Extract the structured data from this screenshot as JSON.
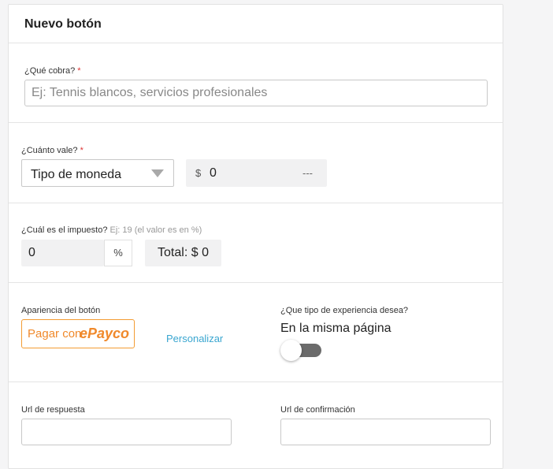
{
  "header": {
    "title": "Nuevo botón"
  },
  "charge": {
    "label": "¿Qué cobra?",
    "required_mark": "*",
    "placeholder": "Ej: Tennis blancos, servicios profesionales"
  },
  "price": {
    "label": "¿Cuánto vale?",
    "required_mark": "*",
    "currency_select": "Tipo de moneda",
    "currency_symbol": "$",
    "amount": "0",
    "amount_suffix": "---"
  },
  "tax": {
    "label": "¿Cuál es el impuesto?",
    "hint": "Ej: 19 (el valor es en %)",
    "value": "0",
    "unit": "%",
    "total": "Total: $ 0"
  },
  "appearance": {
    "label": "Apariencia del botón",
    "button_prefix": "Pagar con",
    "button_brand": "ePayco",
    "customize_link": "Personalizar",
    "brand_color": "#f0892b"
  },
  "experience": {
    "label": "¿Que tipo de experiencia desea?",
    "value": "En la misma página",
    "toggle_on": false
  },
  "urls": {
    "response_label": "Url de respuesta",
    "confirmation_label": "Url de confirmación",
    "response_value": "",
    "confirmation_value": ""
  }
}
